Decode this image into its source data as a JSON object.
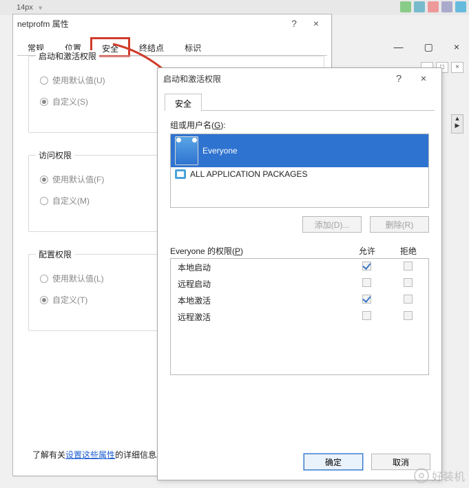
{
  "bg": {
    "font_size_label": "14px"
  },
  "dlg1": {
    "title": "netprofm 属性",
    "help": "?",
    "close": "×",
    "tabs": [
      "常规",
      "位置",
      "安全",
      "终结点",
      "标识"
    ],
    "selected_tab_index": 2,
    "groups": {
      "launch": {
        "title": "启动和激活权限",
        "use_default": "使用默认值(U)",
        "custom": "自定义(S)",
        "selected": "custom"
      },
      "access": {
        "title": "访问权限",
        "use_default": "使用默认值(F)",
        "custom": "自定义(M)",
        "selected": "default"
      },
      "config": {
        "title": "配置权限",
        "use_default": "使用默认值(L)",
        "custom": "自定义(T)",
        "selected": "custom"
      }
    },
    "footer": {
      "prefix": "了解有关",
      "link": "设置这些属性",
      "suffix": "的详细信息。"
    }
  },
  "dlg2": {
    "title": "启动和激活权限",
    "help": "?",
    "close": "×",
    "tab": "安全",
    "groups_label_prefix": "组或用户名(",
    "groups_label_u": "G",
    "groups_label_suffix": "):",
    "principals": [
      {
        "icon": "group",
        "name": "Everyone",
        "selected": true
      },
      {
        "icon": "pkg",
        "name": "ALL APPLICATION PACKAGES",
        "selected": false
      }
    ],
    "add_btn": "添加(D)...",
    "remove_btn": "删除(R)",
    "perm_label_prefix": "Everyone 的权限(",
    "perm_label_u": "P",
    "perm_label_suffix": ")",
    "col_allow": "允许",
    "col_deny": "拒绝",
    "perms": [
      {
        "name": "本地启动",
        "allow": true,
        "deny": false
      },
      {
        "name": "远程启动",
        "allow": false,
        "deny": false
      },
      {
        "name": "本地激活",
        "allow": true,
        "deny": false
      },
      {
        "name": "远程激活",
        "allow": false,
        "deny": false
      }
    ],
    "ok": "确定",
    "cancel": "取消"
  },
  "watermark": "好装机"
}
